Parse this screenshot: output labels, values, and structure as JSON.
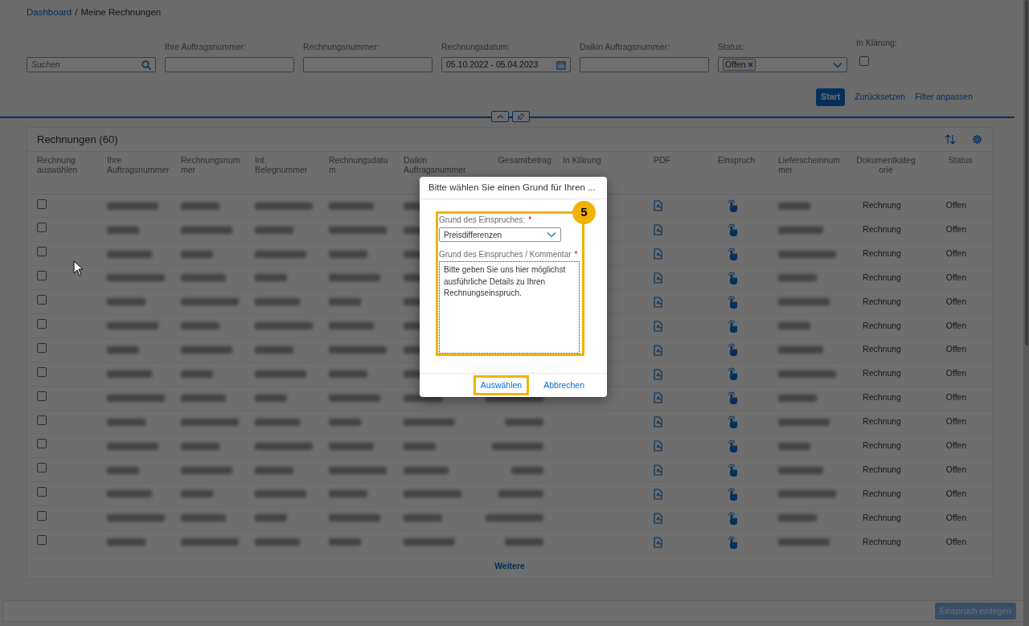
{
  "breadcrumb": [
    {
      "label": "Dashboard",
      "link": true
    },
    {
      "label": "Meine Rechnungen",
      "link": false
    }
  ],
  "breadcrumb_separator": "/",
  "filters": [
    {
      "kind": "search",
      "placeholder": "Suchen"
    },
    {
      "kind": "text",
      "label": "Ihre Auftragsnummer:"
    },
    {
      "kind": "text",
      "label": "Rechnungsnummer:"
    },
    {
      "kind": "date",
      "label": "Rechnungsdatum:",
      "value": "05.10.2022 - 05.04.2023"
    },
    {
      "kind": "text",
      "label": "Daikin Auftragsnummer:"
    },
    {
      "kind": "multiselect",
      "label": "Status:",
      "tokens": [
        "Offen"
      ]
    },
    {
      "kind": "checkbox",
      "label": "In Klärung:",
      "checked": false
    }
  ],
  "filter_actions": [
    {
      "label": "Start",
      "kind": "primary"
    },
    {
      "label": "Zurücksetzen",
      "kind": "link"
    },
    {
      "label": "Filter anpassen",
      "kind": "link"
    }
  ],
  "table": {
    "title": "Rechnungen (60)",
    "columns": [
      {
        "label": "Rechnung auswählen",
        "kind": "checkbox"
      },
      {
        "label": "Ihre Auftragsnummer",
        "kind": "redacted"
      },
      {
        "label": "Rechnungsnummer",
        "kind": "redacted"
      },
      {
        "label": "Int. Belegnummer",
        "kind": "redacted"
      },
      {
        "label": "Rechnungsdatum",
        "kind": "redacted"
      },
      {
        "label": "Daikin Auftragsnummer",
        "kind": "redacted"
      },
      {
        "label": "Gesamtbetrag",
        "kind": "amount"
      },
      {
        "label": "In Klärung",
        "kind": "empty"
      },
      {
        "label": "PDF",
        "kind": "pdf"
      },
      {
        "label": "Einspruch",
        "kind": "appeal"
      },
      {
        "label": "Lieferscheinnummer",
        "kind": "redacted"
      },
      {
        "label": "Dokumentkategorie",
        "kind": "category"
      },
      {
        "label": "Status",
        "kind": "status"
      }
    ],
    "rows": [
      {
        "selected": false,
        "category": "Rechnung",
        "status": "Offen"
      },
      {
        "selected": false,
        "category": "Rechnung",
        "status": "Offen"
      },
      {
        "selected": false,
        "category": "Rechnung",
        "status": "Offen"
      },
      {
        "selected": false,
        "category": "Rechnung",
        "status": "Offen"
      },
      {
        "selected": false,
        "category": "Rechnung",
        "status": "Offen"
      },
      {
        "selected": false,
        "category": "Rechnung",
        "status": "Offen"
      },
      {
        "selected": false,
        "category": "Rechnung",
        "status": "Offen"
      },
      {
        "selected": false,
        "category": "Rechnung",
        "status": "Offen"
      },
      {
        "selected": false,
        "category": "Rechnung",
        "status": "Offen"
      },
      {
        "selected": false,
        "category": "Rechnung",
        "status": "Offen"
      },
      {
        "selected": false,
        "category": "Rechnung",
        "status": "Offen"
      },
      {
        "selected": false,
        "category": "Rechnung",
        "status": "Offen"
      },
      {
        "selected": false,
        "category": "Rechnung",
        "status": "Offen"
      },
      {
        "selected": false,
        "category": "Rechnung",
        "status": "Offen"
      },
      {
        "selected": false,
        "category": "Rechnung",
        "status": "Offen"
      }
    ],
    "more": "Weitere"
  },
  "footer_button": {
    "label": "Einspruch einlegen",
    "disabled": true
  },
  "dialog": {
    "title": "Bitte wählen Sie einen Grund für Ihren ...",
    "step_badge": "5",
    "highlighted": true,
    "fields": [
      {
        "kind": "select",
        "label": "Grund des Einspruches:",
        "required_mark": "*",
        "value": "Preisdifferenzen"
      },
      {
        "kind": "textarea",
        "label": "Grund des Einspruches / Kommentar",
        "required_mark": "*",
        "placeholder": "Bitte geben Sie uns hier möglichst ausführliche Details zu Ihren Rechnungseinspruch."
      }
    ],
    "buttons": [
      {
        "label": "Auswählen",
        "highlighted": true
      },
      {
        "label": "Abbrechen",
        "highlighted": false
      }
    ]
  }
}
